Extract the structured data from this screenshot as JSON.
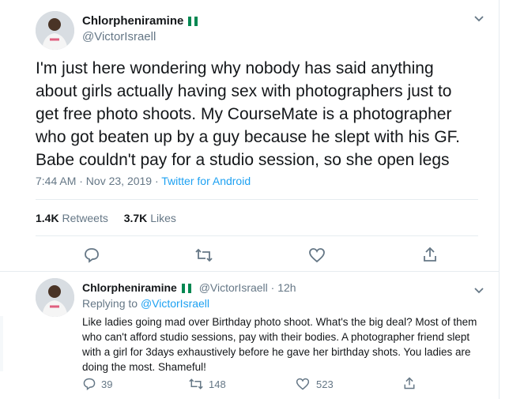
{
  "tweet": {
    "name": "Chlorpheniramine",
    "handle": "@VictorIsraell",
    "text": "I'm just here wondering why nobody has said anything about girls actually having sex with photographers just to get free photo shoots. My CourseMate is a photographer who got beaten up by a guy because he slept with his GF. Babe couldn't pay for a studio session, so she open legs",
    "time": "7:44 AM · Nov 23, 2019 · ",
    "source": "Twitter for Android",
    "retweets_count": "1.4K",
    "retweets_label": "Retweets",
    "likes_count": "3.7K",
    "likes_label": "Likes"
  },
  "reply": {
    "name": "Chlorpheniramine",
    "handle_time": "@VictorIsraell · 12h",
    "replying_prefix": "Replying to ",
    "replying_to": "@VictorIsraell",
    "text": "Like ladies going mad over Birthday photo shoot. What's the big deal? Most of them who can't afford studio sessions, pay  with their bodies. A photographer friend slept with a girl for 3days exhaustively before he gave her birthday shots. You ladies are doing the most. Shameful!",
    "replies": "39",
    "retweets": "148",
    "likes": "523"
  },
  "colors": {
    "accent": "#1da1f2",
    "muted": "#657786",
    "flag_green": "#008751"
  }
}
